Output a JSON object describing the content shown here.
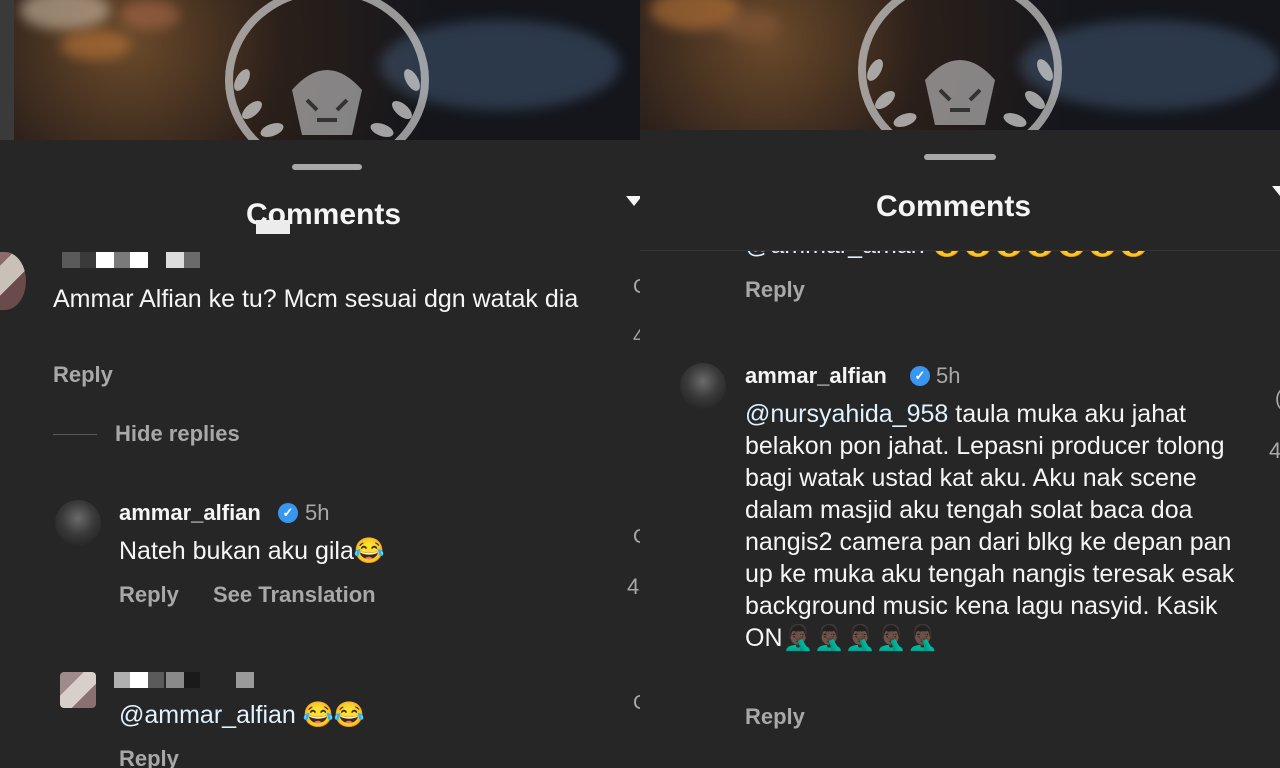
{
  "left": {
    "title": "Comments",
    "comment1": {
      "text": "Ammar Alfian ke tu? Mcm sesuai dgn watak dia",
      "reply_label": "Reply"
    },
    "hide_replies_label": "Hide replies",
    "reply1": {
      "username": "ammar_alfian",
      "time": "5h",
      "text": "Nateh bukan aku gila😂",
      "reply_label": "Reply",
      "see_translation_label": "See Translation"
    },
    "reply2": {
      "text": "@ammar_alfian 😂😂",
      "reply_label": "Reply"
    },
    "edge_glyphs": [
      "C",
      "4",
      "C",
      "4",
      "C"
    ]
  },
  "right": {
    "title": "Comments",
    "partial_text": "@ammar_aman 😍😍😍😍😍😍😍",
    "partial_reply_label": "Reply",
    "comment": {
      "username": "ammar_alfian",
      "time": "5h",
      "mention": "@nursyahida_958",
      "text": " taula muka aku jahat belakon pon jahat. Lepasni producer tolong bagi watak ustad kat aku. Aku nak scene dalam masjid aku tengah solat baca doa nangis2 camera pan dari blkg ke depan pan up ke muka aku tengah nangis teresak esak  background music kena lagu nasyid. Kasik ON🤦🏿‍♂️🤦🏿‍♂️🤦🏿‍♂️🤦🏿‍♂️🤦🏿‍♂️",
      "reply_label": "Reply"
    },
    "edge_glyphs": [
      "(",
      "4"
    ]
  },
  "colors": {
    "background": "#262626",
    "secondary_text": "#a8a8a8",
    "verified_badge": "#3897f0",
    "mention": "#e0f1ff"
  },
  "icons": [
    "filter-icon",
    "verified-badge-icon",
    "drag-handle"
  ]
}
